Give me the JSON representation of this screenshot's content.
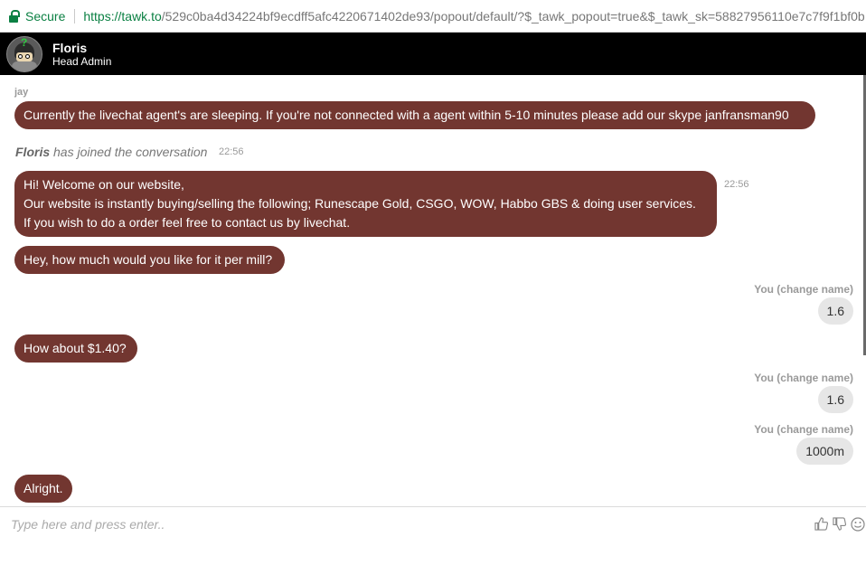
{
  "browser": {
    "secure_label": "Secure",
    "url_scheme": "https://",
    "url_host": "tawk.to",
    "url_rest": "/529c0ba4d34224bf9ecdff5afc4220671402de93/popout/default/?$_tawk_popout=true&$_tawk_sk=58827956110e7c7f9f1bf0b"
  },
  "header": {
    "agent_name": "Floris",
    "agent_role": "Head Admin"
  },
  "messages": {
    "m1_sender": "jay",
    "m1_text": "Currently the livechat agent's are sleeping. If you're not connected with a agent within 5-10 minutes please add our skype janfransman90",
    "join_name": "Floris",
    "join_text": " has joined the conversation",
    "join_time": "22:56",
    "m2_line1": "Hi! Welcome on our website,",
    "m2_line2": "Our website is instantly buying/selling the following; Runescape Gold, CSGO, WOW, Habbo GBS & doing user services.",
    "m2_line3": "If you wish to do a order feel free to contact us by livechat.",
    "m2_time": "22:56",
    "m3_text": "Hey, how much would you like for it per mill?",
    "r1_sender": "You (change name)",
    "r1_text": "1.6",
    "m4_text": "How about $1.40?",
    "r2_sender": "You (change name)",
    "r2_text": "1.6",
    "r3_sender": "You (change name)",
    "r3_text": "1000m",
    "m5_text": "Alright."
  },
  "input": {
    "placeholder": "Type here and press enter.."
  },
  "icons": {
    "thumbs_up": "thumbs-up-icon",
    "thumbs_down": "thumbs-down-icon",
    "emoji": "emoji-icon"
  },
  "colors": {
    "agent_bubble": "#723630",
    "visitor_bubble": "#e6e6e6",
    "header_bg": "#000000",
    "secure_green": "#0b8043"
  }
}
